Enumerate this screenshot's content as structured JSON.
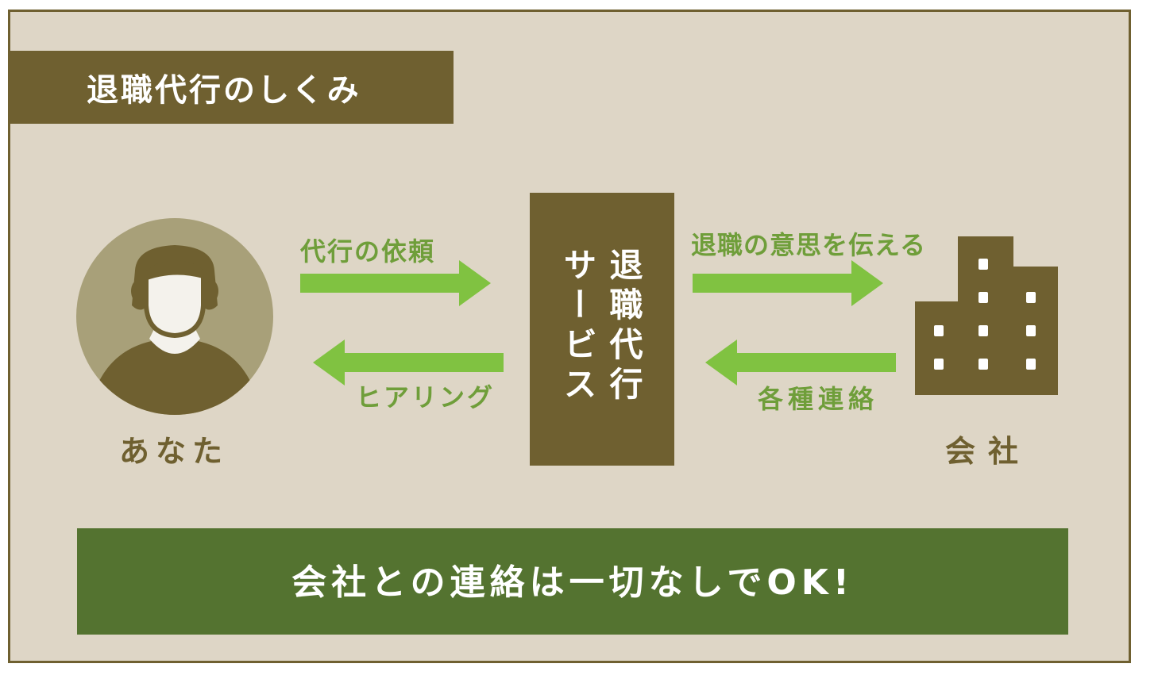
{
  "title": "退職代行のしくみ",
  "nodes": {
    "you": "あなた",
    "service_right": "退職代行",
    "service_left": "サービス",
    "company": "会社"
  },
  "edges": {
    "request": "代行の依頼",
    "hearing": "ヒアリング",
    "tell_intention": "退職の意思を伝える",
    "various_contact": "各種連絡"
  },
  "banner": "会社との連絡は一切なしでOK!",
  "colors": {
    "frame_bg": "#ded6c6",
    "brown": "#6f6030",
    "arrow_green": "#80c241",
    "label_green": "#6f9e3a",
    "banner_green": "#547330",
    "avatar_circle": "#a8a079"
  },
  "icons": {
    "person": "person-icon",
    "building": "building-icon"
  }
}
